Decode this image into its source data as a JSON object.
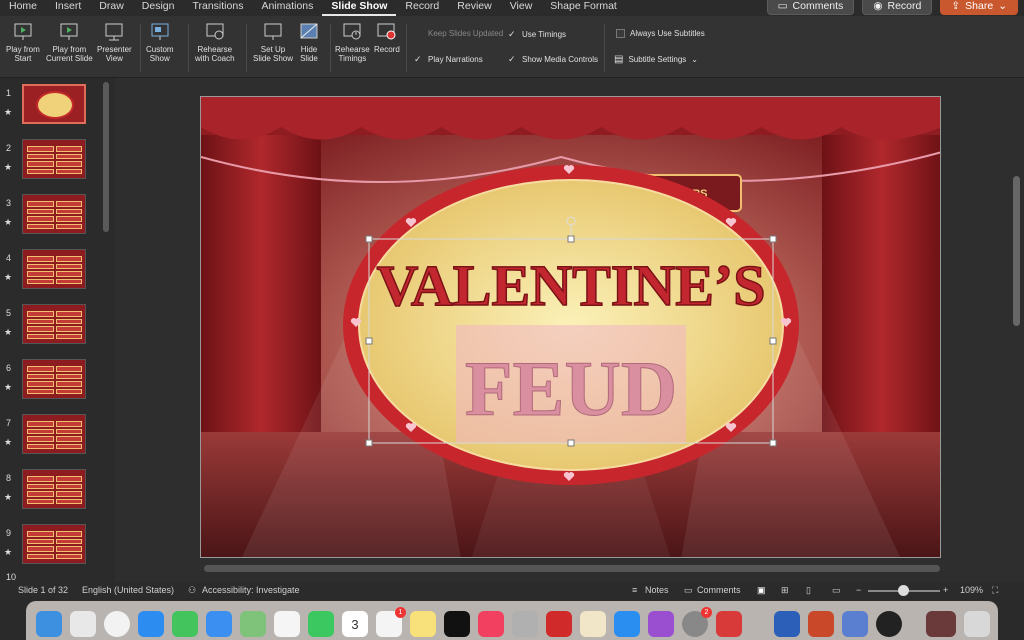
{
  "menu": {
    "tabs": [
      "Home",
      "Insert",
      "Draw",
      "Design",
      "Transitions",
      "Animations",
      "Slide Show",
      "Record",
      "Review",
      "View",
      "Shape Format"
    ],
    "active_tab": "Slide Show",
    "comments_label": "Comments",
    "record_label": "Record",
    "share_label": "Share"
  },
  "ribbon": {
    "play_from_start": "Play from\nStart",
    "play_from_current": "Play from\nCurrent Slide",
    "presenter_view": "Presenter\nView",
    "custom_show": "Custom\nShow",
    "rehearse_coach": "Rehearse\nwith Coach",
    "set_up": "Set Up\nSlide Show",
    "hide_slide": "Hide\nSlide",
    "rehearse_timings": "Rehearse\nTimings",
    "record": "Record",
    "keep_slides_updated": "Keep Slides Updated",
    "use_timings": "Use Timings",
    "play_narrations": "Play Narrations",
    "show_media_controls": "Show Media Controls",
    "always_use_subtitles": "Always Use Subtitles",
    "subtitle_settings": "Subtitle Settings"
  },
  "thumbnails": {
    "numbers": [
      "1",
      "2",
      "3",
      "4",
      "5",
      "6",
      "7",
      "8",
      "9",
      "10"
    ],
    "star": "★"
  },
  "slide": {
    "title_line1": "VALENTINE’S",
    "title_line2": "FEUD",
    "sign_text": "WERS"
  },
  "status": {
    "slide_counter": "Slide 1 of 32",
    "language": "English (United States)",
    "accessibility": "Accessibility: Investigate",
    "notes": "Notes",
    "comments": "Comments",
    "zoom": "109%"
  },
  "dock": {
    "calendar_day": "3",
    "calendar_month": "SAT",
    "badges": [
      "1",
      "2"
    ]
  }
}
